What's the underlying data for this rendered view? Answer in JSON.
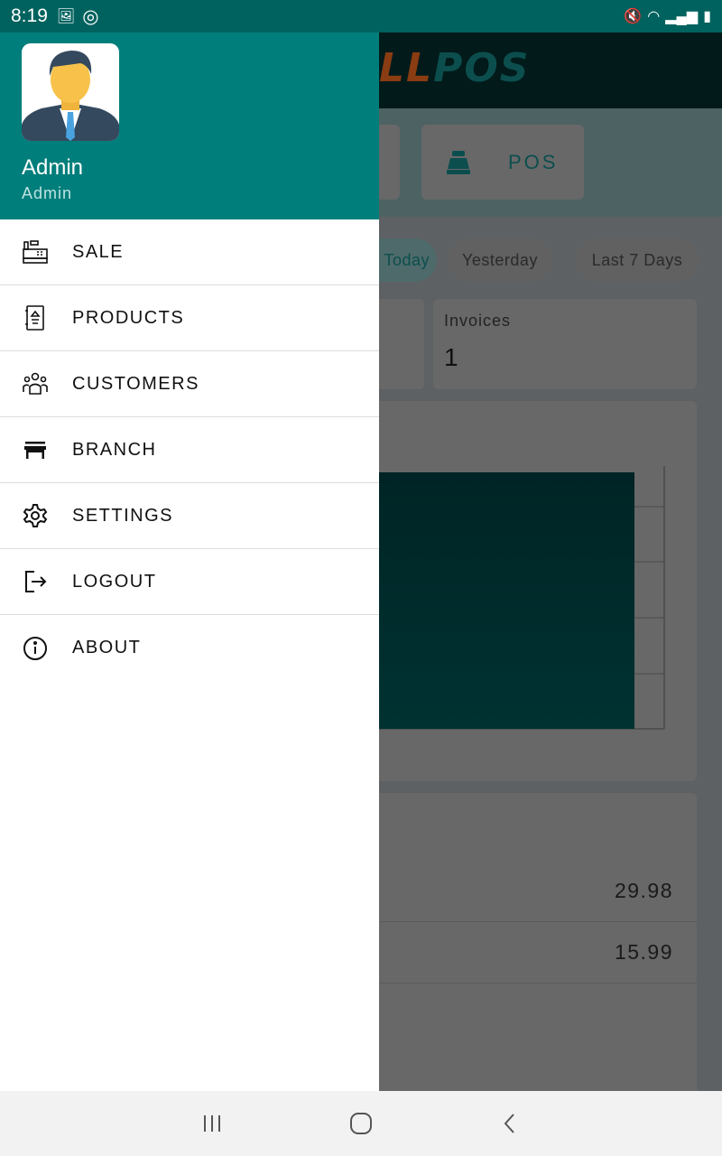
{
  "status_bar": {
    "time": "8:19",
    "icons": [
      "image-icon",
      "sync-icon",
      "mute-icon",
      "wifi-icon",
      "signal-icon",
      "battery-icon"
    ]
  },
  "background_app": {
    "logo": {
      "part1": "LL",
      "part2": "POS"
    },
    "pos_button": {
      "label": "POS",
      "icon": "cash-register-icon"
    },
    "filters": [
      "Today",
      "Yesterday",
      "Last 7 Days"
    ],
    "filters_visible": [
      "oday",
      "Yesterday",
      "Last 7 Days"
    ],
    "invoices": {
      "label": "Invoices",
      "value": "1"
    },
    "table_values": [
      "29.98",
      "15.99"
    ],
    "colors": {
      "accent": "#008080",
      "bar": "#006b6b"
    }
  },
  "drawer": {
    "user": {
      "name": "Admin",
      "role": "Admin"
    },
    "items": [
      {
        "label": "SALE",
        "icon": "cash-register-icon"
      },
      {
        "label": "PRODUCTS",
        "icon": "product-catalog-icon"
      },
      {
        "label": "CUSTOMERS",
        "icon": "customers-icon"
      },
      {
        "label": "BRANCH",
        "icon": "store-icon"
      },
      {
        "label": "SETTINGS",
        "icon": "gear-icon"
      },
      {
        "label": "LOGOUT",
        "icon": "logout-icon"
      },
      {
        "label": "ABOUT",
        "icon": "info-icon"
      }
    ],
    "header_color": "#007e7b"
  },
  "nav_bar": {
    "buttons": [
      "recents",
      "home",
      "back"
    ]
  }
}
